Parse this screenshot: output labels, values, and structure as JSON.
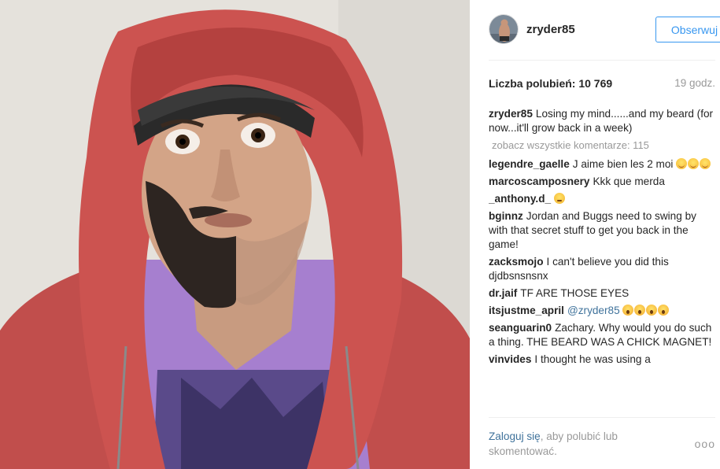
{
  "post": {
    "image_alt": "Man in red hoodie and cap with half-shaved beard",
    "colors": {
      "hoodie": "#c8524f",
      "shirt": "#a67fcf",
      "wall": "#e5e2dc"
    }
  },
  "header": {
    "username": "zryder85",
    "follow_label": "Obserwuj"
  },
  "meta": {
    "likes": "Liczba polubień: 10 769",
    "time": "19 godz."
  },
  "caption": {
    "user": "zryder85",
    "text": "Losing my mind......and my beard (for now...it'll grow back in a week)"
  },
  "view_all": "zobacz wszystkie komentarze: 115",
  "comments": [
    {
      "user": "legendre_gaelle",
      "text": "J aime bien les 2 moi",
      "emoji": [
        "smile",
        "smile",
        "smile"
      ]
    },
    {
      "user": "marcoscamposnery",
      "text": "Kkk que merda"
    },
    {
      "user": "_anthony.d_",
      "text": "",
      "emoji": [
        "worry"
      ]
    },
    {
      "user": "bginnz",
      "text": "Jordan and Buggs need to swing by with that secret stuff to get you back in the game!"
    },
    {
      "user": "zacksmojo",
      "text": "I can't believe you did this djdbsnsnsnx"
    },
    {
      "user": "dr.jaif",
      "text": "TF ARE THOSE EYES"
    },
    {
      "user": "itsjustme_april",
      "mention": "@zryder85",
      "text": "",
      "emoji": [
        "scream",
        "scream",
        "scream",
        "scream"
      ]
    },
    {
      "user": "seanguarin0",
      "text": "Zachary. Why would you do such a thing. THE BEARD WAS A CHICK MAGNET!"
    },
    {
      "user": "vinvides",
      "text": "I thought he was using a"
    }
  ],
  "login": {
    "link": "Zaloguj się",
    "rest": ", aby polubić lub skomentować."
  },
  "more_icon": "ellipsis-icon",
  "more_glyph": "ooo"
}
